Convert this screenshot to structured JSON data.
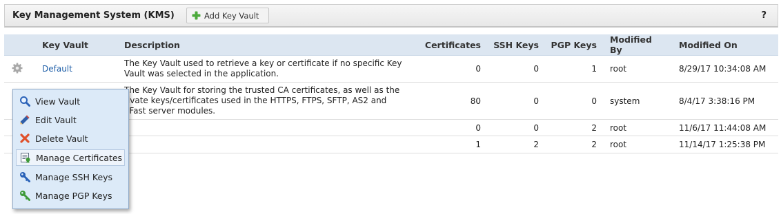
{
  "header": {
    "title": "Key Management System (KMS)",
    "add_button": "Add Key Vault",
    "help": "?"
  },
  "table": {
    "columns": [
      "Key Vault",
      "Description",
      "Certificates",
      "SSH Keys",
      "PGP Keys",
      "Modified By",
      "Modified On"
    ],
    "rows": [
      {
        "name": "Default",
        "description": "The Key Vault used to retrieve a key or certificate if no specific Key Vault was selected in the application.",
        "certificates": "0",
        "ssh_keys": "0",
        "pgp_keys": "1",
        "modified_by": "root",
        "modified_on": "8/29/17 10:34:08 AM"
      },
      {
        "name": "",
        "description": "The Key Vault for storing the trusted CA certificates, as well as the rivate keys/certificates used in the HTTPS, FTPS, SFTP, AS2 and oFast server modules.",
        "certificates": "80",
        "ssh_keys": "0",
        "pgp_keys": "0",
        "modified_by": "system",
        "modified_on": "8/4/17 3:38:16 PM"
      },
      {
        "name": "",
        "description": "",
        "certificates": "0",
        "ssh_keys": "0",
        "pgp_keys": "2",
        "modified_by": "root",
        "modified_on": "11/6/17 11:44:08 AM"
      },
      {
        "name": "",
        "description": "",
        "certificates": "1",
        "ssh_keys": "2",
        "pgp_keys": "2",
        "modified_by": "root",
        "modified_on": "11/14/17 1:25:38 PM"
      }
    ]
  },
  "context_menu": {
    "items": [
      {
        "label": "View Vault",
        "icon": "magnifier-icon"
      },
      {
        "label": "Edit Vault",
        "icon": "pencil-icon"
      },
      {
        "label": "Delete Vault",
        "icon": "delete-x-icon"
      },
      {
        "label": "Manage Certificates",
        "icon": "certificate-icon"
      },
      {
        "label": "Manage SSH Keys",
        "icon": "blue-key-icon"
      },
      {
        "label": "Manage PGP Keys",
        "icon": "green-key-icon"
      }
    ],
    "active_item": "Manage Certificates"
  },
  "colors": {
    "link": "#1f5fa8",
    "header_row": "#dce6f1",
    "menu_bg": "#dceaf8"
  }
}
